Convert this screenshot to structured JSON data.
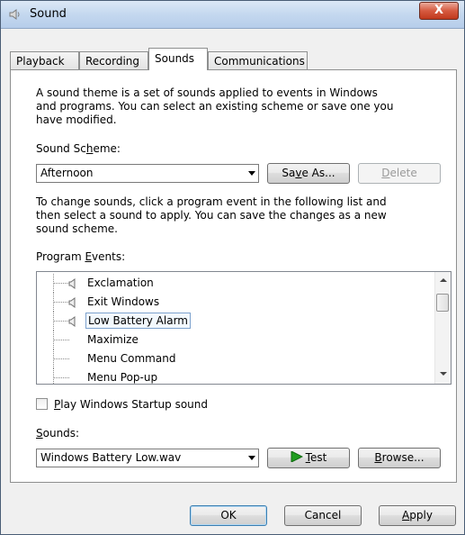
{
  "window": {
    "title": "Sound",
    "close_glyph": "X"
  },
  "tabs": [
    {
      "label": "Playback"
    },
    {
      "label": "Recording"
    },
    {
      "label": "Sounds"
    },
    {
      "label": "Communications"
    }
  ],
  "intro_lines": [
    "A sound theme is a set of sounds applied to events in Windows",
    "and programs.  You can select an existing scheme or save one you",
    "have modified."
  ],
  "scheme": {
    "label_pre": "Sound Sc",
    "label_ul": "h",
    "label_post": "eme:",
    "value": "Afternoon",
    "save_pre": "Sa",
    "save_ul": "v",
    "save_post": "e As...",
    "delete_ul": "D",
    "delete_post": "elete"
  },
  "change_lines": [
    "To change sounds, click a program event in the following list and",
    "then select a sound to apply.  You can save the changes as a new",
    "sound scheme."
  ],
  "events": {
    "label_pre": "Program ",
    "label_ul": "E",
    "label_post": "vents:",
    "items": [
      {
        "label": "Exclamation",
        "has_sound": true
      },
      {
        "label": "Exit Windows",
        "has_sound": true
      },
      {
        "label": "Low Battery Alarm",
        "has_sound": true,
        "selected": true
      },
      {
        "label": "Maximize",
        "has_sound": false
      },
      {
        "label": "Menu Command",
        "has_sound": false
      },
      {
        "label": "Menu Pop-up",
        "has_sound": false
      }
    ]
  },
  "startup": {
    "ul": "P",
    "post": "lay Windows Startup sound",
    "checked": false
  },
  "sounds": {
    "label_ul": "S",
    "label_post": "ounds:",
    "value": "Windows Battery Low.wav",
    "test_ul": "T",
    "test_post": "est",
    "browse_ul": "B",
    "browse_post": "rowse..."
  },
  "footer": {
    "ok": "OK",
    "cancel": "Cancel",
    "apply_ul": "A",
    "apply_post": "pply"
  },
  "colors": {
    "accent_play": "#1e9c1e",
    "title_gradient_top": "#dce8f6"
  }
}
